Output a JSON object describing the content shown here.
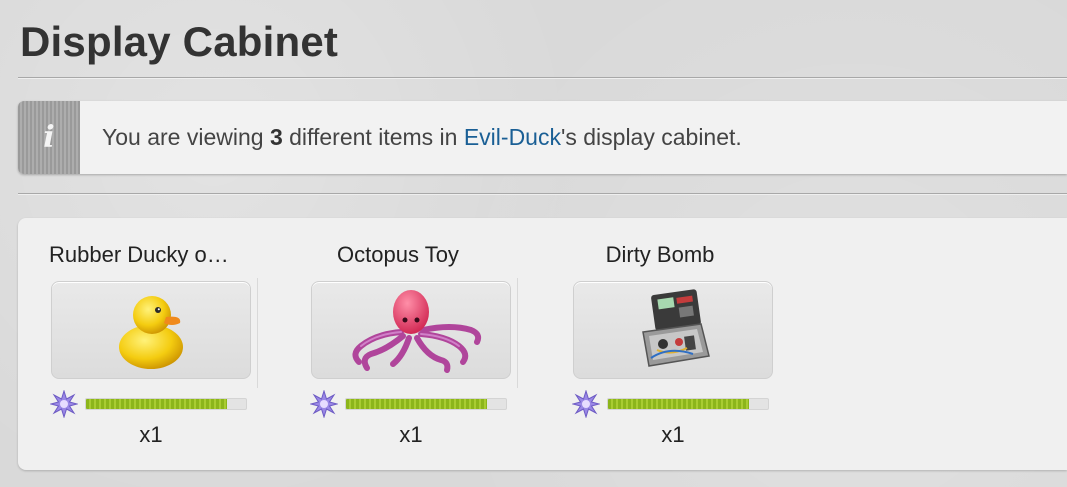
{
  "page": {
    "title": "Display Cabinet"
  },
  "info": {
    "prefix": "You are viewing ",
    "count": "3",
    "middle": " different items in ",
    "user": "Evil-Duck",
    "suffix": "'s display cabinet.",
    "icon": "info-icon"
  },
  "items": [
    {
      "name": "Rubber Ducky o…",
      "qty": "x1",
      "rarity_fill": 0.88,
      "image": "rubber-duck-image"
    },
    {
      "name": "Octopus Toy",
      "qty": "x1",
      "rarity_fill": 0.88,
      "image": "octopus-toy-image"
    },
    {
      "name": "Dirty Bomb",
      "qty": "x1",
      "rarity_fill": 0.88,
      "image": "dirty-bomb-image"
    }
  ],
  "colors": {
    "link": "#1a5f95",
    "bar_fill": "#8cb51b",
    "rarity_star": "#8d7bd9"
  }
}
